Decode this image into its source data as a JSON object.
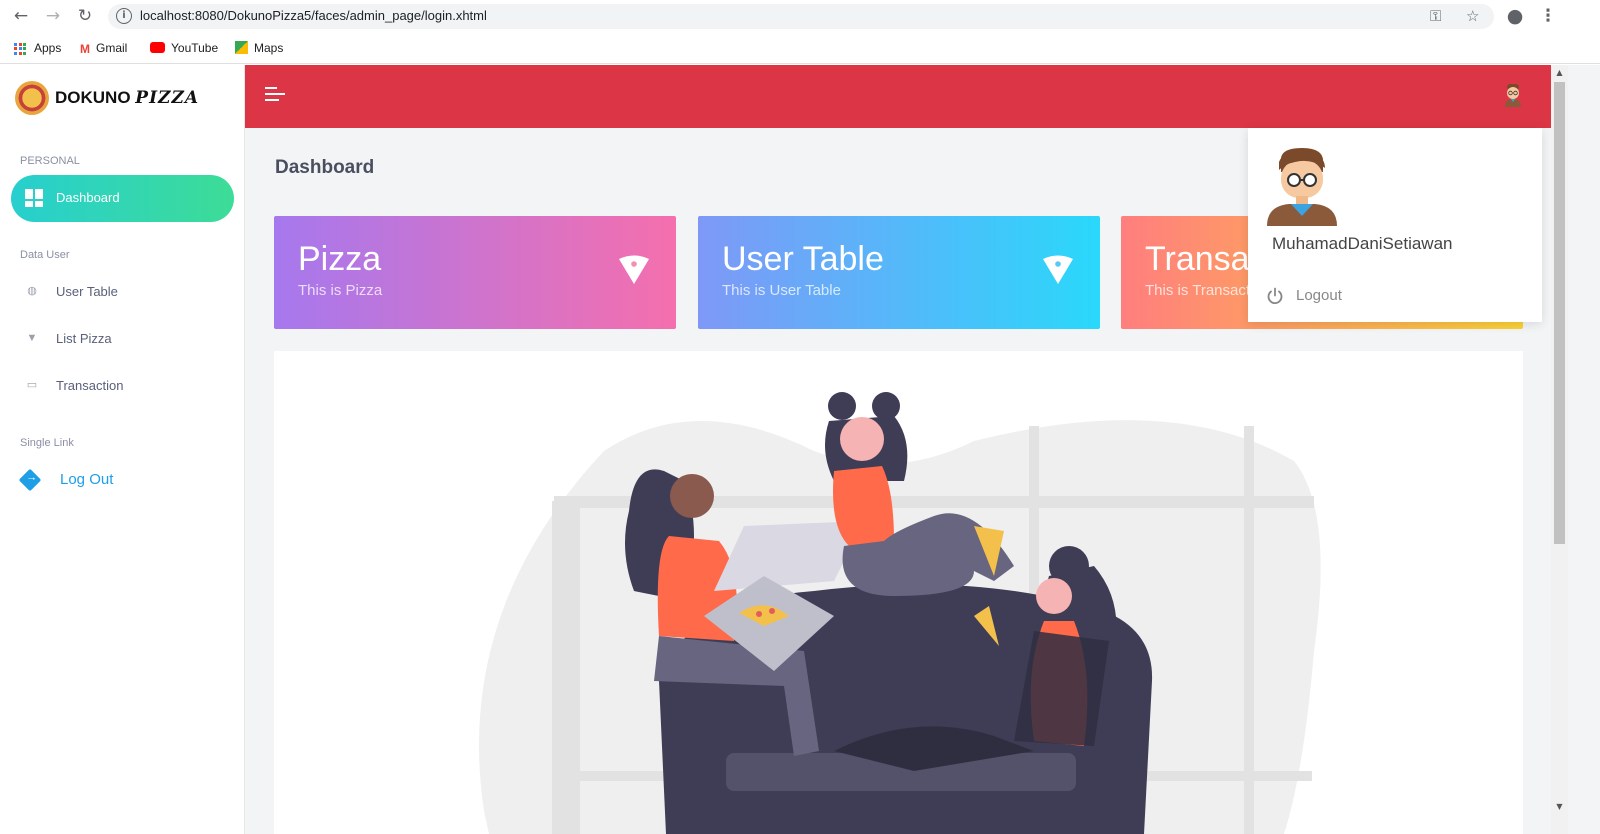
{
  "browser": {
    "url": "localhost:8080/DokunoPizza5/faces/admin_page/login.xhtml",
    "bookmarks": [
      "Apps",
      "Gmail",
      "YouTube",
      "Maps"
    ]
  },
  "brand": {
    "name_plain": "DOKUNO",
    "name_styled": "PIZZA"
  },
  "sidebar": {
    "section_personal": "PERSONAL",
    "dashboard_label": "Dashboard",
    "section_data_user": "Data User",
    "items": [
      {
        "label": "User Table",
        "icon": "globe-icon"
      },
      {
        "label": "List Pizza",
        "icon": "pizza-icon"
      },
      {
        "label": "Transaction",
        "icon": "card-icon"
      }
    ],
    "section_single_link": "Single Link",
    "logout_label": "Log Out"
  },
  "main": {
    "title": "Dashboard",
    "cards": [
      {
        "title": "Pizza",
        "subtitle": "This is Pizza",
        "gradient": [
          "#a678ee",
          "#f56fad"
        ]
      },
      {
        "title": "User Table",
        "subtitle": "This is User Table",
        "gradient": [
          "#7f98f7",
          "#2ad8fb"
        ]
      },
      {
        "title": "Transaction",
        "subtitle": "This is Transaction",
        "gradient": [
          "#ff7e7e",
          "#fbd236"
        ]
      }
    ]
  },
  "user_dropdown": {
    "name": "MuhamadDaniSetiawan",
    "logout_label": "Logout"
  },
  "colors": {
    "topbar": "#dc3545",
    "accent_green": "#3ddc97",
    "link_blue": "#1f9ee8"
  }
}
